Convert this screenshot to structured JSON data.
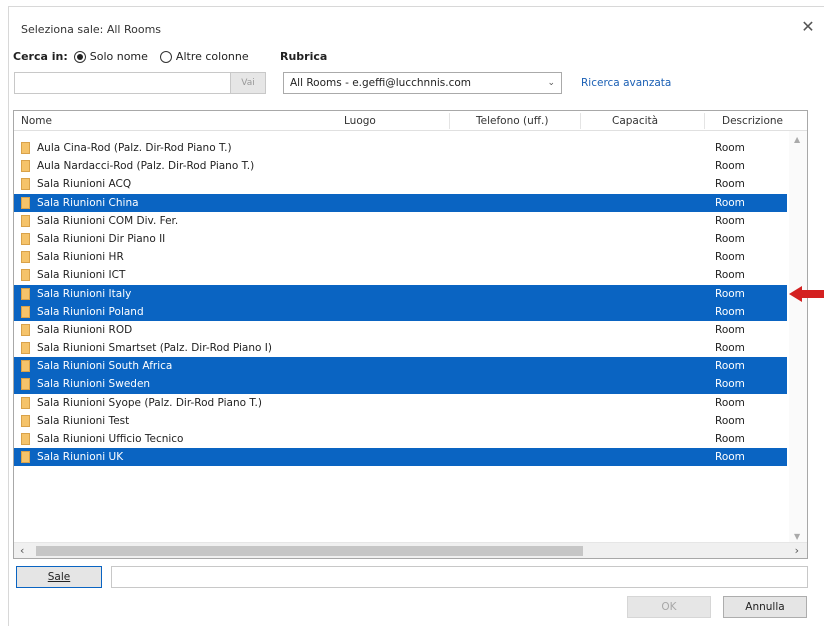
{
  "window": {
    "title": "Seleziona sale: All Rooms"
  },
  "search": {
    "label": "Cerca in:",
    "option1": "Solo nome",
    "option2": "Altre colonne",
    "option1_selected": true,
    "go_label": "Vai",
    "placeholder": ""
  },
  "rubrica": {
    "label": "Rubrica",
    "selected": "All Rooms - e.geffi@lucchnnis.com",
    "advanced_link": "Ricerca avanzata"
  },
  "columns": [
    "Nome",
    "Luogo",
    "Telefono (uff.)",
    "Capacità",
    "Descrizione"
  ],
  "rooms": [
    {
      "name": "Aula Cina-Rod (Palz. Dir-Rod Piano T.)",
      "desc": "Room",
      "selected": false
    },
    {
      "name": "Aula Nardacci-Rod (Palz. Dir-Rod Piano T.)",
      "desc": "Room",
      "selected": false
    },
    {
      "name": "Sala Riunioni ACQ",
      "desc": "Room",
      "selected": false
    },
    {
      "name": "Sala Riunioni China",
      "desc": "Room",
      "selected": true
    },
    {
      "name": "Sala Riunioni COM Div. Fer.",
      "desc": "Room",
      "selected": false
    },
    {
      "name": "Sala Riunioni Dir Piano II",
      "desc": "Room",
      "selected": false
    },
    {
      "name": "Sala Riunioni HR",
      "desc": "Room",
      "selected": false
    },
    {
      "name": "Sala Riunioni ICT",
      "desc": "Room",
      "selected": false
    },
    {
      "name": "Sala Riunioni Italy",
      "desc": "Room",
      "selected": true
    },
    {
      "name": "Sala Riunioni Poland",
      "desc": "Room",
      "selected": true
    },
    {
      "name": "Sala Riunioni ROD",
      "desc": "Room",
      "selected": false
    },
    {
      "name": "Sala Riunioni Smartset (Palz. Dir-Rod Piano I)",
      "desc": "Room",
      "selected": false
    },
    {
      "name": "Sala Riunioni South Africa",
      "desc": "Room",
      "selected": true
    },
    {
      "name": "Sala Riunioni Sweden",
      "desc": "Room",
      "selected": true
    },
    {
      "name": "Sala Riunioni Syope (Palz. Dir-Rod Piano T.)",
      "desc": "Room",
      "selected": false
    },
    {
      "name": "Sala Riunioni Test",
      "desc": "Room",
      "selected": false
    },
    {
      "name": "Sala Riunioni Ufficio Tecnico",
      "desc": "Room",
      "selected": false
    },
    {
      "name": "Sala Riunioni UK",
      "desc": "Room",
      "selected": true
    }
  ],
  "footer": {
    "sale_button": "Sale",
    "sale_field_value": "",
    "ok": "OK",
    "cancel": "Annulla"
  },
  "colors": {
    "selection": "#0a64c2",
    "link": "#1a5fb4",
    "arrow": "#d42020"
  },
  "icons": [
    "close-icon",
    "room-icon",
    "chevron-down-icon",
    "scroll-arrow-icon",
    "red-arrow-icon"
  ]
}
